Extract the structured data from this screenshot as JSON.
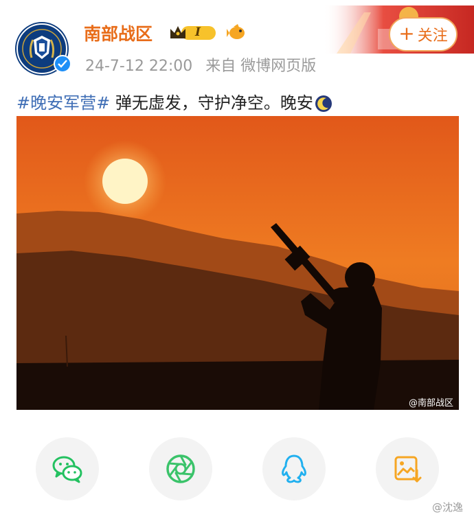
{
  "post": {
    "account_name": "南部战区",
    "level_badge": "I",
    "timestamp": "24-7-12 22:00",
    "source": "来自 微博网页版",
    "follow_label": "关注",
    "follow_icon": "+",
    "hashtag": "#晚安军营#",
    "body": " 弹无虚发，守护净空。晚安",
    "image_watermark": "@南部战区"
  },
  "share_bar": {
    "buttons": [
      {
        "name": "wechat-share",
        "icon": "wechat-icon",
        "color": "#23c160"
      },
      {
        "name": "moments-share",
        "icon": "aperture-icon",
        "color": "#3ac36a"
      },
      {
        "name": "qq-share",
        "icon": "qq-penguin-icon",
        "color": "#21b0ef"
      },
      {
        "name": "save-image",
        "icon": "save-image-icon",
        "color": "#f6a623"
      }
    ]
  },
  "watermark": "@沈逸",
  "colors": {
    "accent": "#e86d1a",
    "hashtag": "#3e6db5",
    "meta_text": "#9a9a9a"
  }
}
